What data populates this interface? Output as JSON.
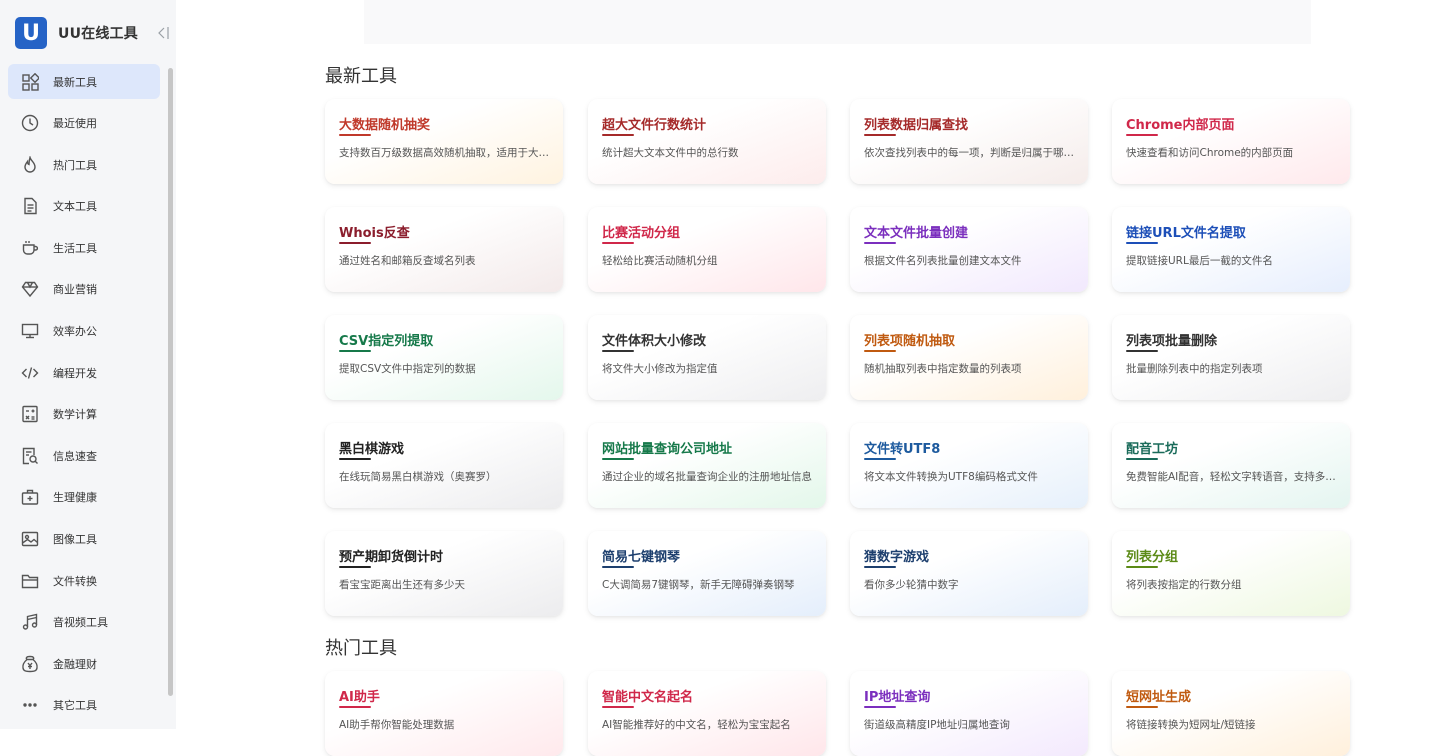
{
  "app": {
    "logo_letter": "U",
    "name": "UU在线工具",
    "collapse_icon": "collapse-left-icon"
  },
  "sidebar": {
    "items": [
      {
        "label": "最新工具",
        "icon": "grid-icon",
        "active": true
      },
      {
        "label": "最近使用",
        "icon": "clock-icon"
      },
      {
        "label": "热门工具",
        "icon": "fire-icon"
      },
      {
        "label": "文本工具",
        "icon": "document-icon"
      },
      {
        "label": "生活工具",
        "icon": "cup-icon"
      },
      {
        "label": "商业营销",
        "icon": "diamond-icon"
      },
      {
        "label": "效率办公",
        "icon": "monitor-icon"
      },
      {
        "label": "编程开发",
        "icon": "code-icon"
      },
      {
        "label": "数学计算",
        "icon": "calculator-icon"
      },
      {
        "label": "信息速查",
        "icon": "search-doc-icon"
      },
      {
        "label": "生理健康",
        "icon": "medical-kit-icon"
      },
      {
        "label": "图像工具",
        "icon": "image-icon"
      },
      {
        "label": "文件转换",
        "icon": "folder-icon"
      },
      {
        "label": "音视频工具",
        "icon": "music-icon"
      },
      {
        "label": "金融理财",
        "icon": "money-bag-icon"
      },
      {
        "label": "其它工具",
        "icon": "more-icon"
      }
    ]
  },
  "sections": [
    {
      "title": "最新工具",
      "cards": [
        {
          "title": "大数据随机抽奖",
          "desc": "支持数百万级数据高效随机抽取，适用于大型活动抽奖",
          "color": "#c0392b",
          "glow": "#fff3e0"
        },
        {
          "title": "超大文件行数统计",
          "desc": "统计超大文本文件中的总行数",
          "color": "#a52a2a",
          "glow": "#fdecec"
        },
        {
          "title": "列表数据归属查找",
          "desc": "依次查找列表中的每一项，判断是归属于哪个分组",
          "color": "#a52a2a",
          "glow": "#f5ecea"
        },
        {
          "title": "Chrome内部页面",
          "desc": "快速查看和访问Chrome的内部页面",
          "color": "#d0284a",
          "glow": "#ffe9ec"
        },
        {
          "title": "Whois反查",
          "desc": "通过姓名和邮箱反查域名列表",
          "color": "#8b1d2c",
          "glow": "#f3eaea"
        },
        {
          "title": "比赛活动分组",
          "desc": "轻松给比赛活动随机分组",
          "color": "#d0284a",
          "glow": "#ffe6ea"
        },
        {
          "title": "文本文件批量创建",
          "desc": "根据文件名列表批量创建文本文件",
          "color": "#7b2fbe",
          "glow": "#f1e8fd"
        },
        {
          "title": "链接URL文件名提取",
          "desc": "提取链接URL最后一截的文件名",
          "color": "#1d4fb8",
          "glow": "#e6eefd"
        },
        {
          "title": "CSV指定列提取",
          "desc": "提取CSV文件中指定列的数据",
          "color": "#16794a",
          "glow": "#e4f7ec"
        },
        {
          "title": "文件体积大小修改",
          "desc": "将文件大小修改为指定值",
          "color": "#333333",
          "glow": "#eeeef0"
        },
        {
          "title": "列表项随机抽取",
          "desc": "随机抽取列表中指定数量的列表项",
          "color": "#c05a10",
          "glow": "#fff0dc"
        },
        {
          "title": "列表项批量删除",
          "desc": "批量删除列表中的指定列表项",
          "color": "#333333",
          "glow": "#eeeef0"
        },
        {
          "title": "黑白棋游戏",
          "desc": "在线玩简易黑白棋游戏（奥赛罗）",
          "color": "#222222",
          "glow": "#ececee"
        },
        {
          "title": "网站批量查询公司地址",
          "desc": "通过企业的域名批量查询企业的注册地址信息",
          "color": "#16794a",
          "glow": "#e3f7ea"
        },
        {
          "title": "文件转UTF8",
          "desc": "将文本文件转换为UTF8编码格式文件",
          "color": "#1d5a9e",
          "glow": "#e6f0fb"
        },
        {
          "title": "配音工坊",
          "desc": "免费智能AI配音，轻松文字转语音，支持多种音色",
          "color": "#1a6b5a",
          "glow": "#e4f5f0"
        },
        {
          "title": "预产期卸货倒计时",
          "desc": "看宝宝距离出生还有多少天",
          "color": "#222222",
          "glow": "#ececee"
        },
        {
          "title": "简易七键钢琴",
          "desc": "C大调简易7键钢琴，新手无障碍弹奏钢琴",
          "color": "#1d3f6e",
          "glow": "#e4eefb"
        },
        {
          "title": "猜数字游戏",
          "desc": "看你多少轮猜中数字",
          "color": "#1d3f6e",
          "glow": "#e4eefb"
        },
        {
          "title": "列表分组",
          "desc": "将列表按指定的行数分组",
          "color": "#5b8a16",
          "glow": "#eef8e0"
        }
      ]
    },
    {
      "title": "热门工具",
      "cards": [
        {
          "title": "AI助手",
          "desc": "AI助手帮你智能处理数据",
          "color": "#d0284a",
          "glow": "#ffe9ec"
        },
        {
          "title": "智能中文名起名",
          "desc": "AI智能推荐好的中文名，轻松为宝宝起名",
          "color": "#d0284a",
          "glow": "#ffe6ea"
        },
        {
          "title": "IP地址查询",
          "desc": "街道级高精度IP地址归属地查询",
          "color": "#7b2fbe",
          "glow": "#f3e9fd"
        },
        {
          "title": "短网址生成",
          "desc": "将链接转换为短网址/短链接",
          "color": "#c05a10",
          "glow": "#fff0dc"
        }
      ]
    }
  ]
}
